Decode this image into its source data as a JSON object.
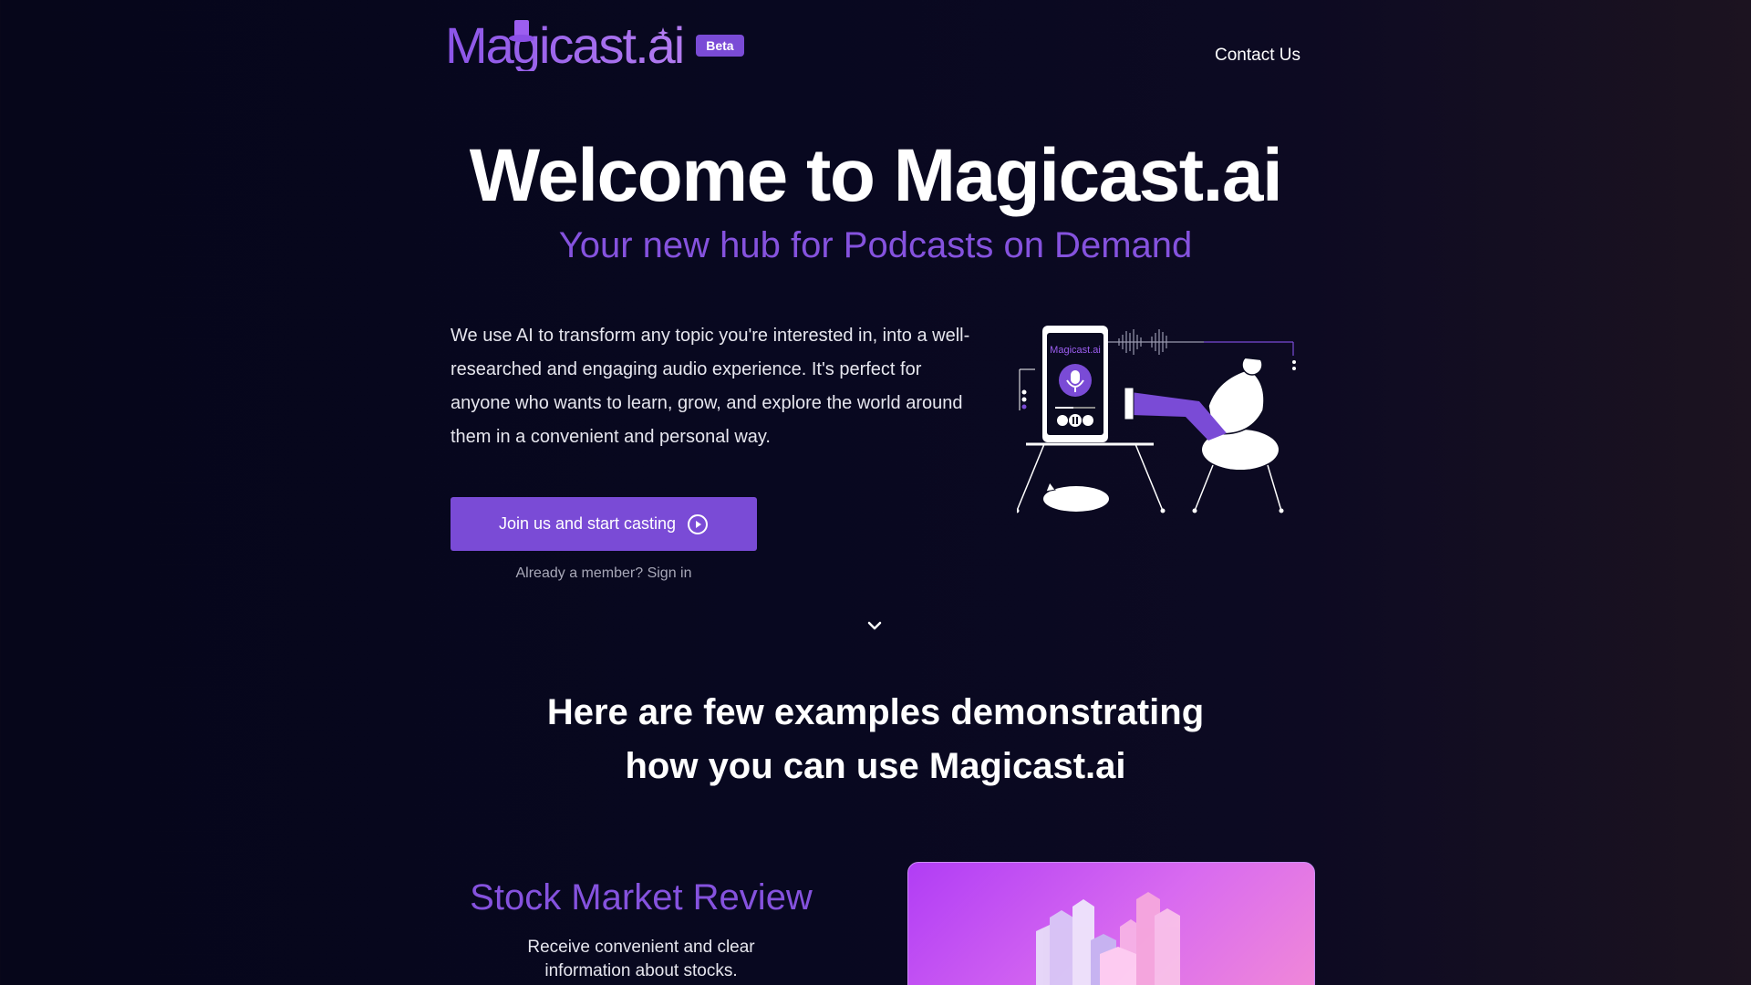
{
  "header": {
    "logo_text": "Magicast.ai",
    "beta_label": "Beta",
    "contact_label": "Contact Us"
  },
  "hero": {
    "title": "Welcome to Magicast.ai",
    "subtitle": "Your new hub for Podcasts on Demand",
    "description": "We use AI to transform any topic you're interested in, into a well-researched and engaging audio experience. It's perfect for anyone who wants to learn, grow, and explore the world around them in a convenient and personal way.",
    "cta_label": "Join us and start casting",
    "signin_text": "Already a member? Sign in",
    "illustration_logo": "Magicast.ai"
  },
  "examples": {
    "title_line1": "Here are few examples demonstrating",
    "title_line2": "how you can use Magicast.ai",
    "items": [
      {
        "title": "Stock Market Review",
        "desc_line1": "Receive convenient and clear",
        "desc_line2": "information about stocks."
      }
    ]
  },
  "icons": [
    "hat-icon",
    "star-icon",
    "play-circle-icon",
    "chevron-down-icon",
    "microphone-icon"
  ],
  "colors": {
    "accent": "#7a4bd6",
    "accent_text": "#8552de",
    "background": "#080820"
  }
}
